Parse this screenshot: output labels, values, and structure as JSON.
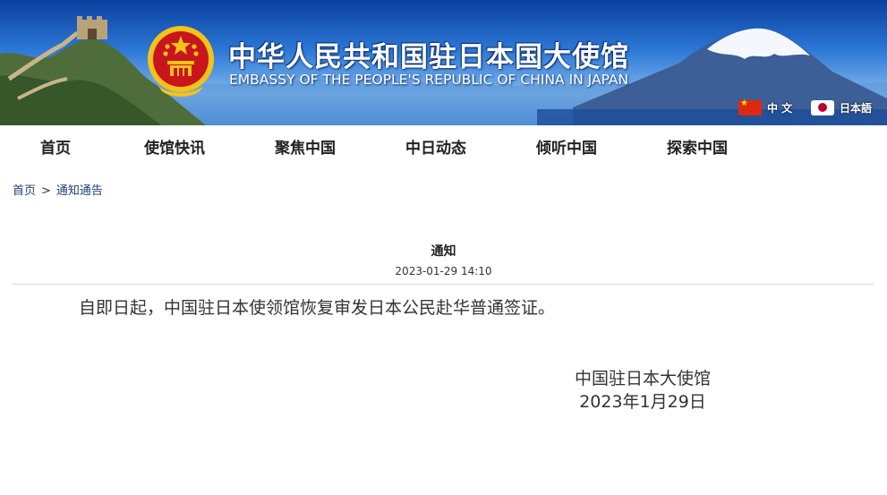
{
  "banner": {
    "title_cn": "中华人民共和国驻日本国大使馆",
    "title_en": "EMBASSY OF THE PEOPLE'S REPUBLIC OF CHINA IN JAPAN",
    "emblem_icon": "national-emblem-icon",
    "colors": {
      "sky": "#2c78d6",
      "emblem_red": "#c8161d",
      "emblem_gold": "#f3c21b"
    }
  },
  "languages": [
    {
      "label": "中 文",
      "icon": "china-flag-icon"
    },
    {
      "label": "日本語",
      "icon": "japan-flag-icon"
    }
  ],
  "nav": {
    "items": [
      "首页",
      "使馆快讯",
      "聚焦中国",
      "中日动态",
      "倾听中国",
      "探索中国"
    ]
  },
  "breadcrumb": {
    "home": "首页",
    "separator": ">",
    "current": "通知通告"
  },
  "article": {
    "title": "通知",
    "date": "2023-01-29 14:10",
    "body": "自即日起，中国驻日本使领馆恢复审发日本公民赴华普通签证。",
    "signature_org": "中国驻日本大使馆",
    "signature_date": "2023年1月29日"
  }
}
